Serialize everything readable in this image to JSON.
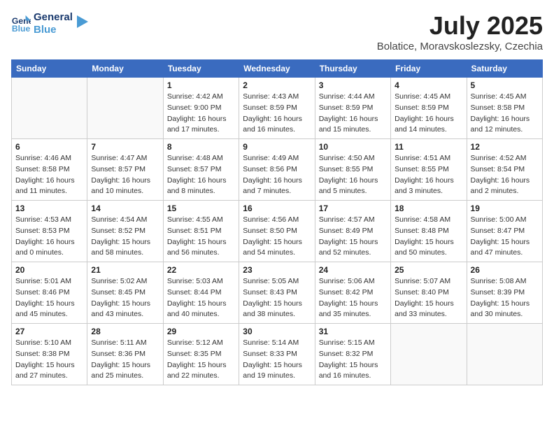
{
  "header": {
    "logo_line1": "General",
    "logo_line2": "Blue",
    "month": "July 2025",
    "location": "Bolatice, Moravskoslezsky, Czechia"
  },
  "days_of_week": [
    "Sunday",
    "Monday",
    "Tuesday",
    "Wednesday",
    "Thursday",
    "Friday",
    "Saturday"
  ],
  "weeks": [
    [
      {
        "day": "",
        "info": ""
      },
      {
        "day": "",
        "info": ""
      },
      {
        "day": "1",
        "info": "Sunrise: 4:42 AM\nSunset: 9:00 PM\nDaylight: 16 hours and 17 minutes."
      },
      {
        "day": "2",
        "info": "Sunrise: 4:43 AM\nSunset: 8:59 PM\nDaylight: 16 hours and 16 minutes."
      },
      {
        "day": "3",
        "info": "Sunrise: 4:44 AM\nSunset: 8:59 PM\nDaylight: 16 hours and 15 minutes."
      },
      {
        "day": "4",
        "info": "Sunrise: 4:45 AM\nSunset: 8:59 PM\nDaylight: 16 hours and 14 minutes."
      },
      {
        "day": "5",
        "info": "Sunrise: 4:45 AM\nSunset: 8:58 PM\nDaylight: 16 hours and 12 minutes."
      }
    ],
    [
      {
        "day": "6",
        "info": "Sunrise: 4:46 AM\nSunset: 8:58 PM\nDaylight: 16 hours and 11 minutes."
      },
      {
        "day": "7",
        "info": "Sunrise: 4:47 AM\nSunset: 8:57 PM\nDaylight: 16 hours and 10 minutes."
      },
      {
        "day": "8",
        "info": "Sunrise: 4:48 AM\nSunset: 8:57 PM\nDaylight: 16 hours and 8 minutes."
      },
      {
        "day": "9",
        "info": "Sunrise: 4:49 AM\nSunset: 8:56 PM\nDaylight: 16 hours and 7 minutes."
      },
      {
        "day": "10",
        "info": "Sunrise: 4:50 AM\nSunset: 8:55 PM\nDaylight: 16 hours and 5 minutes."
      },
      {
        "day": "11",
        "info": "Sunrise: 4:51 AM\nSunset: 8:55 PM\nDaylight: 16 hours and 3 minutes."
      },
      {
        "day": "12",
        "info": "Sunrise: 4:52 AM\nSunset: 8:54 PM\nDaylight: 16 hours and 2 minutes."
      }
    ],
    [
      {
        "day": "13",
        "info": "Sunrise: 4:53 AM\nSunset: 8:53 PM\nDaylight: 16 hours and 0 minutes."
      },
      {
        "day": "14",
        "info": "Sunrise: 4:54 AM\nSunset: 8:52 PM\nDaylight: 15 hours and 58 minutes."
      },
      {
        "day": "15",
        "info": "Sunrise: 4:55 AM\nSunset: 8:51 PM\nDaylight: 15 hours and 56 minutes."
      },
      {
        "day": "16",
        "info": "Sunrise: 4:56 AM\nSunset: 8:50 PM\nDaylight: 15 hours and 54 minutes."
      },
      {
        "day": "17",
        "info": "Sunrise: 4:57 AM\nSunset: 8:49 PM\nDaylight: 15 hours and 52 minutes."
      },
      {
        "day": "18",
        "info": "Sunrise: 4:58 AM\nSunset: 8:48 PM\nDaylight: 15 hours and 50 minutes."
      },
      {
        "day": "19",
        "info": "Sunrise: 5:00 AM\nSunset: 8:47 PM\nDaylight: 15 hours and 47 minutes."
      }
    ],
    [
      {
        "day": "20",
        "info": "Sunrise: 5:01 AM\nSunset: 8:46 PM\nDaylight: 15 hours and 45 minutes."
      },
      {
        "day": "21",
        "info": "Sunrise: 5:02 AM\nSunset: 8:45 PM\nDaylight: 15 hours and 43 minutes."
      },
      {
        "day": "22",
        "info": "Sunrise: 5:03 AM\nSunset: 8:44 PM\nDaylight: 15 hours and 40 minutes."
      },
      {
        "day": "23",
        "info": "Sunrise: 5:05 AM\nSunset: 8:43 PM\nDaylight: 15 hours and 38 minutes."
      },
      {
        "day": "24",
        "info": "Sunrise: 5:06 AM\nSunset: 8:42 PM\nDaylight: 15 hours and 35 minutes."
      },
      {
        "day": "25",
        "info": "Sunrise: 5:07 AM\nSunset: 8:40 PM\nDaylight: 15 hours and 33 minutes."
      },
      {
        "day": "26",
        "info": "Sunrise: 5:08 AM\nSunset: 8:39 PM\nDaylight: 15 hours and 30 minutes."
      }
    ],
    [
      {
        "day": "27",
        "info": "Sunrise: 5:10 AM\nSunset: 8:38 PM\nDaylight: 15 hours and 27 minutes."
      },
      {
        "day": "28",
        "info": "Sunrise: 5:11 AM\nSunset: 8:36 PM\nDaylight: 15 hours and 25 minutes."
      },
      {
        "day": "29",
        "info": "Sunrise: 5:12 AM\nSunset: 8:35 PM\nDaylight: 15 hours and 22 minutes."
      },
      {
        "day": "30",
        "info": "Sunrise: 5:14 AM\nSunset: 8:33 PM\nDaylight: 15 hours and 19 minutes."
      },
      {
        "day": "31",
        "info": "Sunrise: 5:15 AM\nSunset: 8:32 PM\nDaylight: 15 hours and 16 minutes."
      },
      {
        "day": "",
        "info": ""
      },
      {
        "day": "",
        "info": ""
      }
    ]
  ]
}
